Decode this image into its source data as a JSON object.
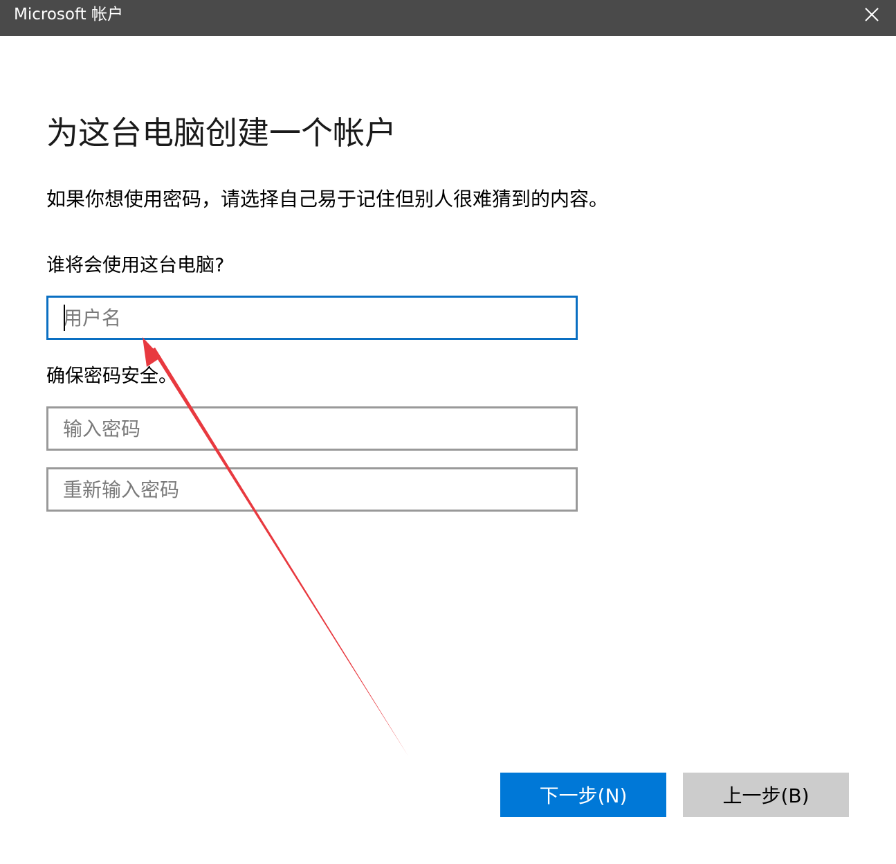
{
  "window": {
    "title": "Microsoft 帐户",
    "close_icon": "close-icon"
  },
  "heading": "为这台电脑创建一个帐户",
  "subtext": "如果你想使用密码，请选择自己易于记住但别人很难猜到的内容。",
  "who_label": "谁将会使用这台电脑?",
  "username": {
    "value": "",
    "placeholder": "用户名"
  },
  "secure_label": "确保密码安全。",
  "password": {
    "value": "",
    "placeholder": "输入密码"
  },
  "password_confirm": {
    "value": "",
    "placeholder": "重新输入密码"
  },
  "buttons": {
    "next": "下一步(N)",
    "back": "上一步(B)"
  },
  "colors": {
    "titlebar": "#4a4a4a",
    "focus_border": "#0a6fc2",
    "primary_button": "#0078d7",
    "secondary_button": "#cccccc",
    "annotation_arrow": "#e8393f"
  }
}
